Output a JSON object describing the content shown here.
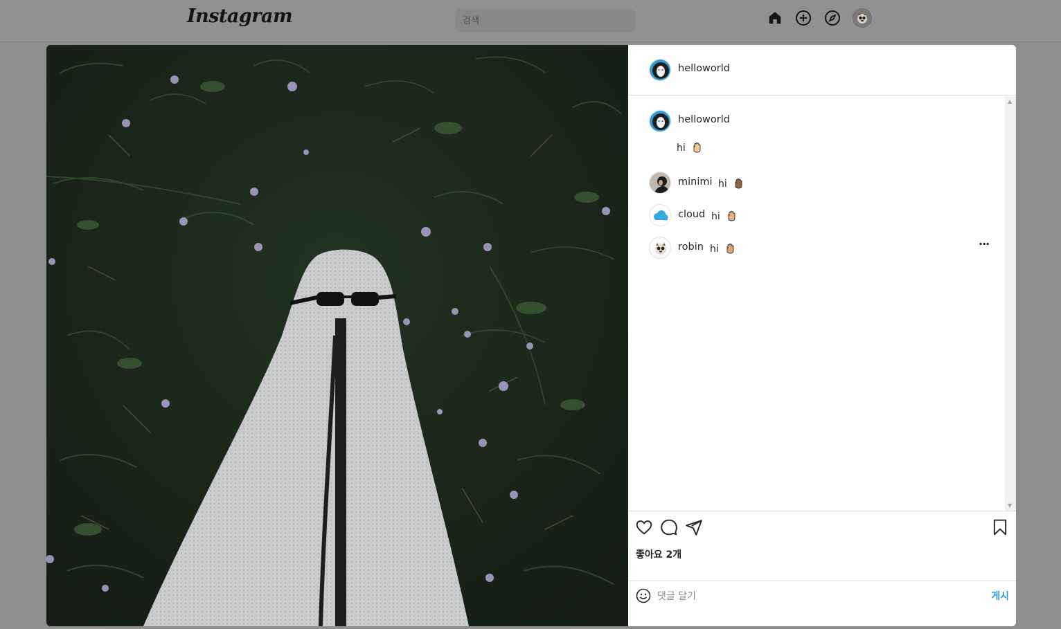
{
  "header": {
    "logo": "Instagram",
    "search_placeholder": "검색",
    "icons": [
      "home-icon",
      "add-post-icon",
      "explore-icon",
      "profile-avatar"
    ]
  },
  "post": {
    "author": "helloworld",
    "caption_author": "helloworld",
    "caption": "hi",
    "comments": [
      {
        "user": "minimi",
        "text": "hi"
      },
      {
        "user": "cloud",
        "text": "hi"
      },
      {
        "user": "robin",
        "text": "hi"
      }
    ],
    "likes_label": "좋아요 2개",
    "comment_placeholder": "댓글 달기",
    "post_button": "게시",
    "more_label": "···"
  },
  "colors": {
    "accent": "#2d9bd8",
    "overlay": "#8e8e8e",
    "grass": "#1d2a1d"
  }
}
